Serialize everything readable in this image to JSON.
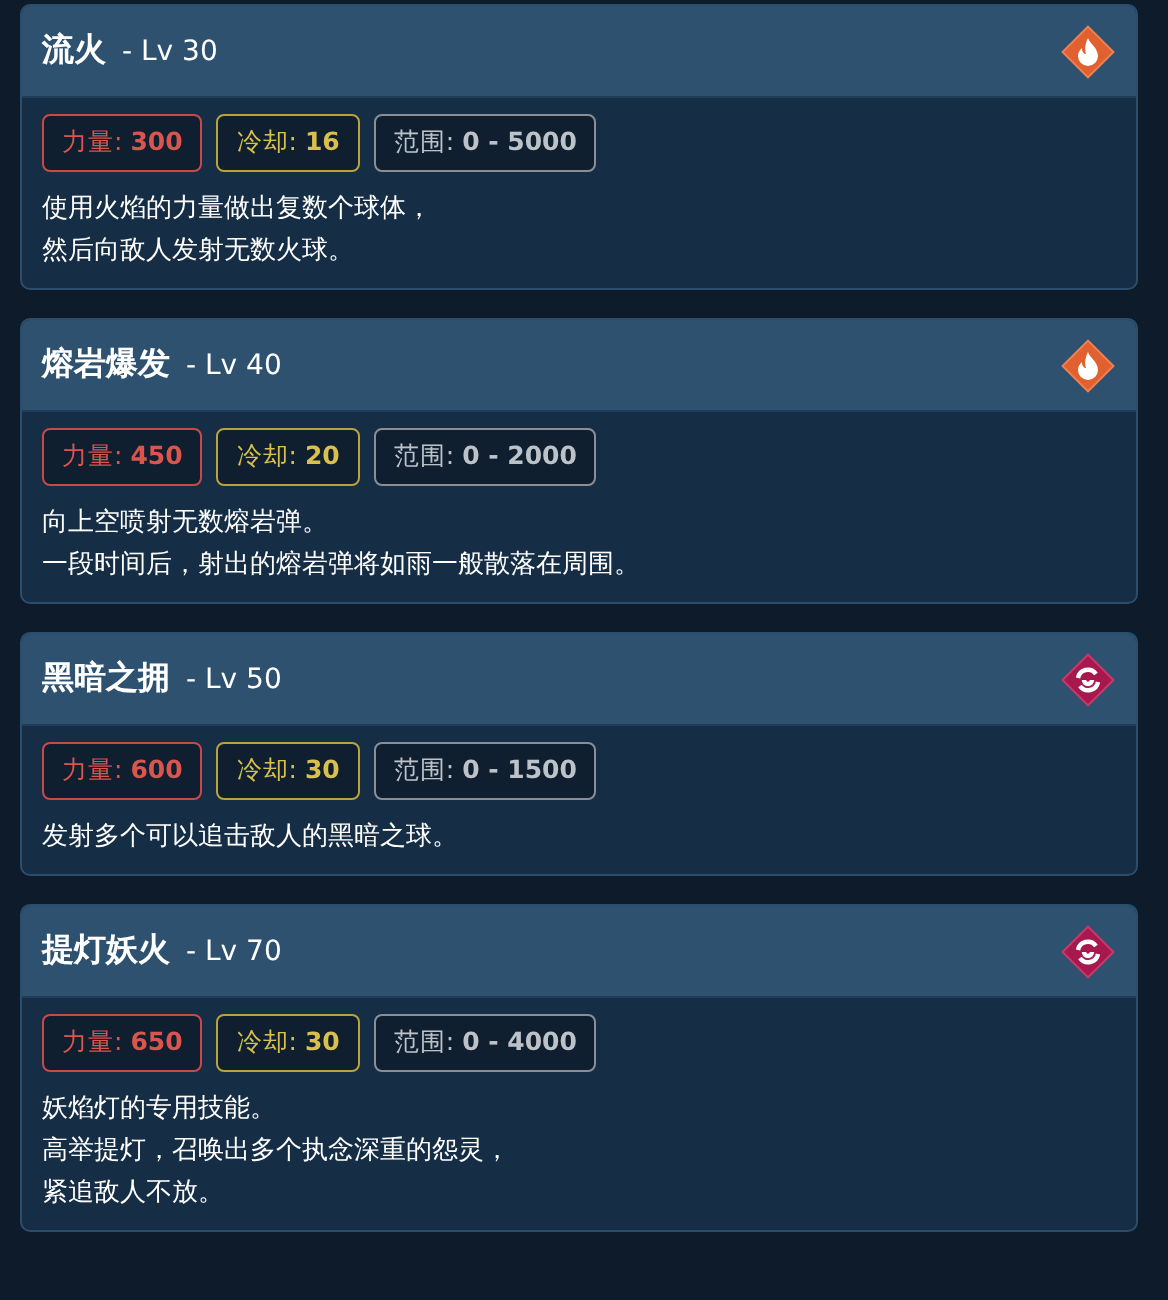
{
  "skills": [
    {
      "name": "流火",
      "level": "- Lv 30",
      "kind": "fire",
      "stats": [
        {
          "kind": "power",
          "text": "力量: **300**"
        },
        {
          "kind": "cooldown",
          "text": "冷却: **16**"
        },
        {
          "kind": "range",
          "text": "范围: **0 - 5000**"
        }
      ],
      "description": [
        "使用火焰的力量做出复数个球体，",
        "然后向敌人发射无数火球。"
      ]
    },
    {
      "name": "熔岩爆发",
      "level": "- Lv 40",
      "kind": "fire",
      "stats": [
        {
          "kind": "power",
          "text": "力量: **450**"
        },
        {
          "kind": "cooldown",
          "text": "冷却: **20**"
        },
        {
          "kind": "range",
          "text": "范围: **0 - 2000**"
        }
      ],
      "description": [
        "向上空喷射无数熔岩弹。",
        "一段时间后，射出的熔岩弹将如雨一般散落在周围。"
      ]
    },
    {
      "name": "黑暗之拥",
      "level": "- Lv 50",
      "kind": "dark",
      "stats": [
        {
          "kind": "power",
          "text": "力量: **600**"
        },
        {
          "kind": "cooldown",
          "text": "冷却: **30**"
        },
        {
          "kind": "range",
          "text": "范围: **0 - 1500**"
        }
      ],
      "description": [
        "发射多个可以追击敌人的黑暗之球。"
      ]
    },
    {
      "name": "提灯妖火",
      "level": "- Lv 70",
      "kind": "dark",
      "stats": [
        {
          "kind": "power",
          "text": "力量: **650**"
        },
        {
          "kind": "cooldown",
          "text": "冷却: **30**"
        },
        {
          "kind": "range",
          "text": "范围: **0 - 4000**"
        }
      ],
      "description": [
        "妖焰灯的专用技能。",
        "高举提灯，召唤出多个执念深重的怨灵，",
        "紧追敌人不放。"
      ]
    }
  ]
}
